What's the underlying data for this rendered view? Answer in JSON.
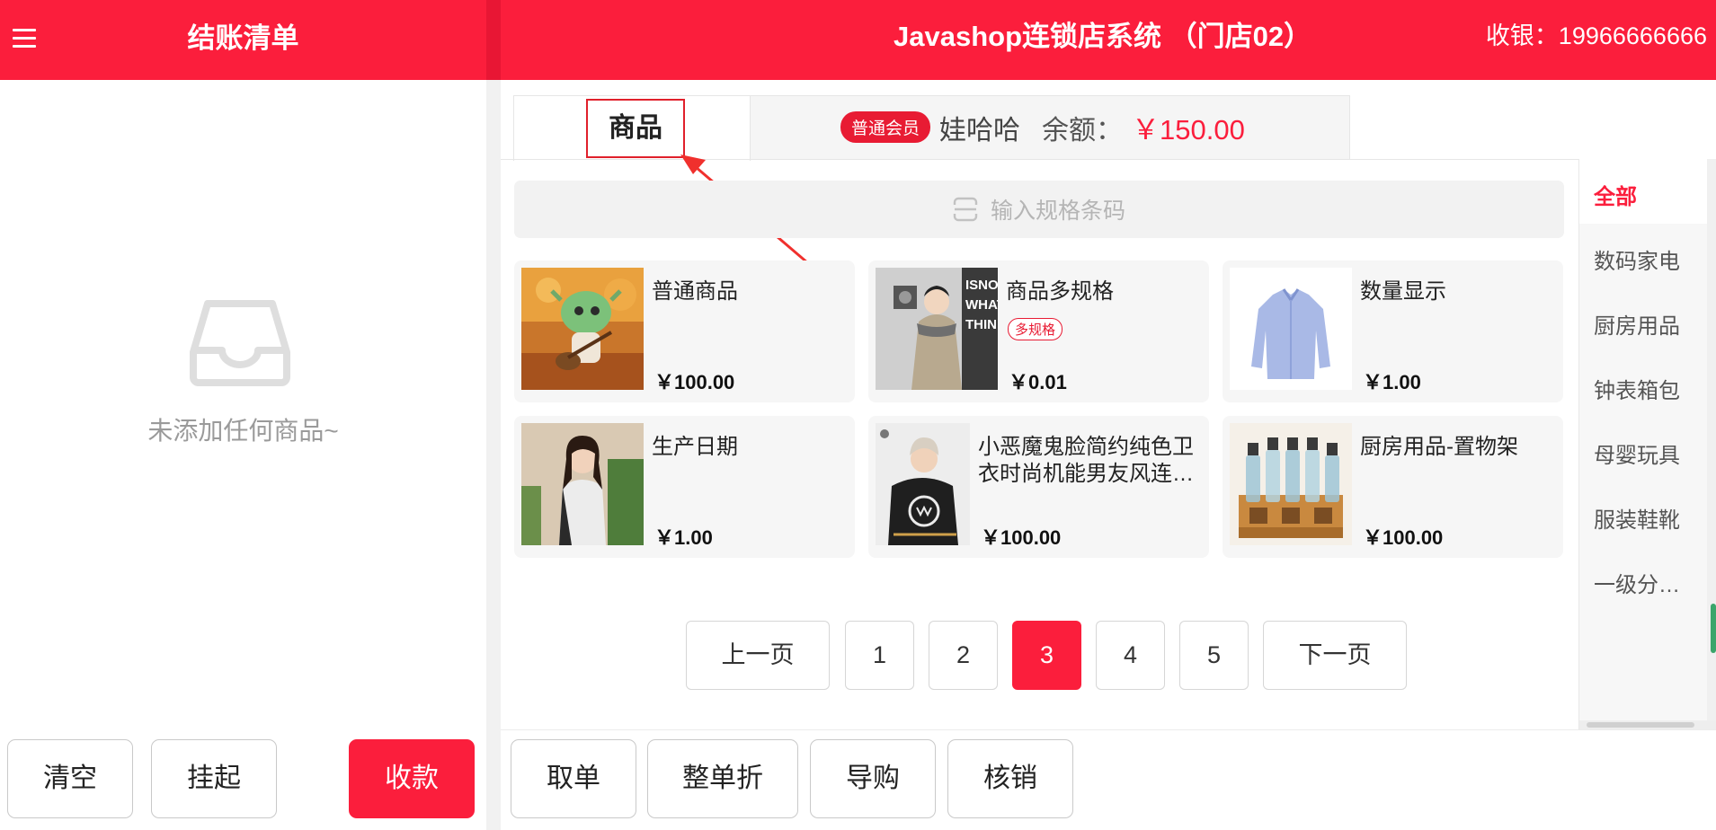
{
  "checkout": {
    "title": "结账清单",
    "empty_text": "未添加任何商品~",
    "buttons": {
      "clear": "清空",
      "hold": "挂起",
      "pay": "收款"
    }
  },
  "header": {
    "store_title": "Javashop连锁店系统 （门店02）",
    "cashier": "收银：19966666666"
  },
  "tabs": {
    "goods": "商品"
  },
  "member": {
    "level": "普通会员",
    "name": "娃哈哈",
    "balance_label": "余额：",
    "balance_value": "￥150.00"
  },
  "barcode": {
    "placeholder": "输入规格条码"
  },
  "products": [
    {
      "name": "普通商品",
      "price": "￥100.00"
    },
    {
      "name": "商品多规格",
      "tag": "多规格",
      "price": "￥0.01"
    },
    {
      "name": "数量显示",
      "price": "￥1.00"
    },
    {
      "name": "生产日期",
      "price": "￥1.00"
    },
    {
      "name": "小恶魔鬼脸简约纯色卫衣时尚机能男友风连…",
      "price": "￥100.00"
    },
    {
      "name": "厨房用品-置物架",
      "price": "￥100.00"
    }
  ],
  "pagination": {
    "prev": "上一页",
    "pages": [
      "1",
      "2",
      "3",
      "4",
      "5"
    ],
    "current": "3",
    "next": "下一页"
  },
  "categories": [
    "全部",
    "数码家电",
    "厨房用品",
    "钟表箱包",
    "母婴玩具",
    "服装鞋靴",
    "一级分…"
  ],
  "actions": {
    "take_order": "取单",
    "whole_discount": "整单折",
    "guide": "导购",
    "verify": "核销"
  },
  "colors": {
    "brand": "#fb1e3c"
  }
}
